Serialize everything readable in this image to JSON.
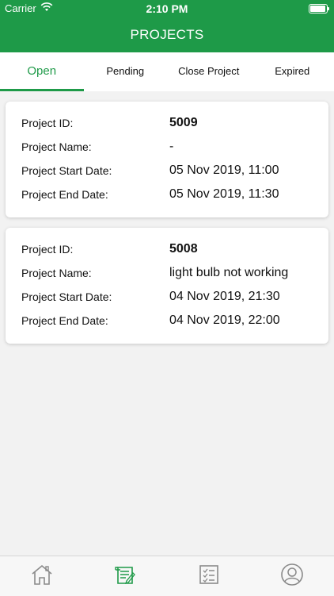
{
  "status_bar": {
    "carrier": "Carrier",
    "time": "2:10 PM"
  },
  "header": {
    "title": "PROJECTS"
  },
  "tabs": [
    {
      "label": "Open",
      "active": true
    },
    {
      "label": "Pending",
      "active": false
    },
    {
      "label": "Close Project",
      "active": false
    },
    {
      "label": "Expired",
      "active": false
    }
  ],
  "labels": {
    "id": "Project ID:",
    "name": "Project Name:",
    "start": "Project Start Date:",
    "end": "Project End Date:"
  },
  "projects": [
    {
      "id": "5009",
      "name": "-",
      "start": "05 Nov 2019, 11:00",
      "end": "05 Nov 2019, 11:30"
    },
    {
      "id": "5008",
      "name": "light bulb not working",
      "start": "04 Nov 2019, 21:30",
      "end": "04 Nov 2019, 22:00"
    }
  ],
  "bottom_nav": {
    "items": [
      {
        "icon": "home-icon",
        "active": false
      },
      {
        "icon": "projects-icon",
        "active": true
      },
      {
        "icon": "checklist-icon",
        "active": false
      },
      {
        "icon": "profile-icon",
        "active": false
      }
    ]
  },
  "colors": {
    "primary": "#1e9a48",
    "background": "#f2f2f2",
    "inactive_icon": "#8a8a8a"
  }
}
